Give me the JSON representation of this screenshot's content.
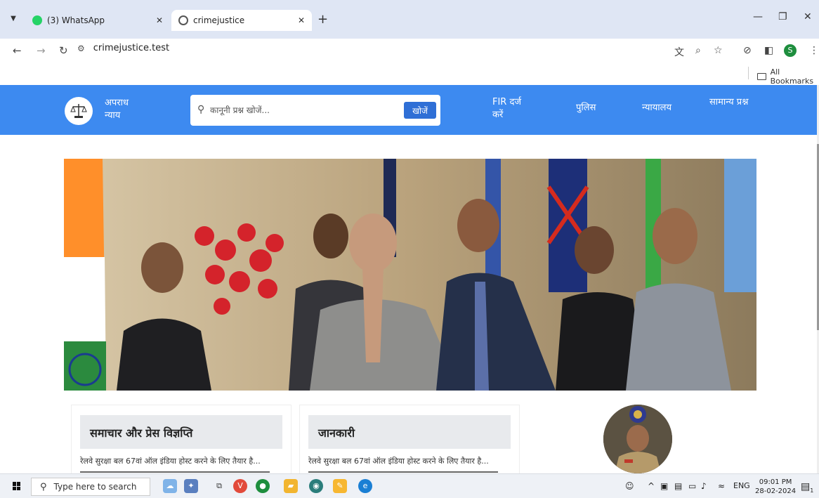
{
  "browser": {
    "tabs": [
      {
        "title": "(3) WhatsApp",
        "active": false,
        "icon": "whatsapp-icon"
      },
      {
        "title": "crimejustice",
        "active": true,
        "icon": "globe-icon"
      }
    ],
    "url": "crimejustice.test",
    "bookmarks_label": "All Bookmarks",
    "profile_initial": "S"
  },
  "site": {
    "logo_text": "अपराध न्याय",
    "search_placeholder": "कानूनी प्रश्न खोजें...",
    "search_button": "खोजें",
    "nav": {
      "fir": "FIR दर्ज करें",
      "police": "पुलिस",
      "court": "न्यायालय",
      "faq": "सामान्य प्रश्न"
    },
    "cards": [
      {
        "title": "समाचार और प्रेस विज्ञप्ति",
        "excerpt": "रेलवे सुरक्षा बल 67वां ऑल इंडिया होस्ट करने के लिए तैयार है..."
      },
      {
        "title": "जानकारी",
        "excerpt": "रेलवे सुरक्षा बल 67वां ऑल इंडिया होस्ट करने के लिए तैयार है..."
      }
    ]
  },
  "taskbar": {
    "search_placeholder": "Type here to search",
    "lang": "ENG",
    "time": "09:01 PM",
    "date": "28-02-2024",
    "notification_count": "1"
  },
  "colors": {
    "nav_bg": "#3d8af0",
    "search_btn": "#2f6fd6",
    "tabstrip": "#dfe6f4"
  }
}
